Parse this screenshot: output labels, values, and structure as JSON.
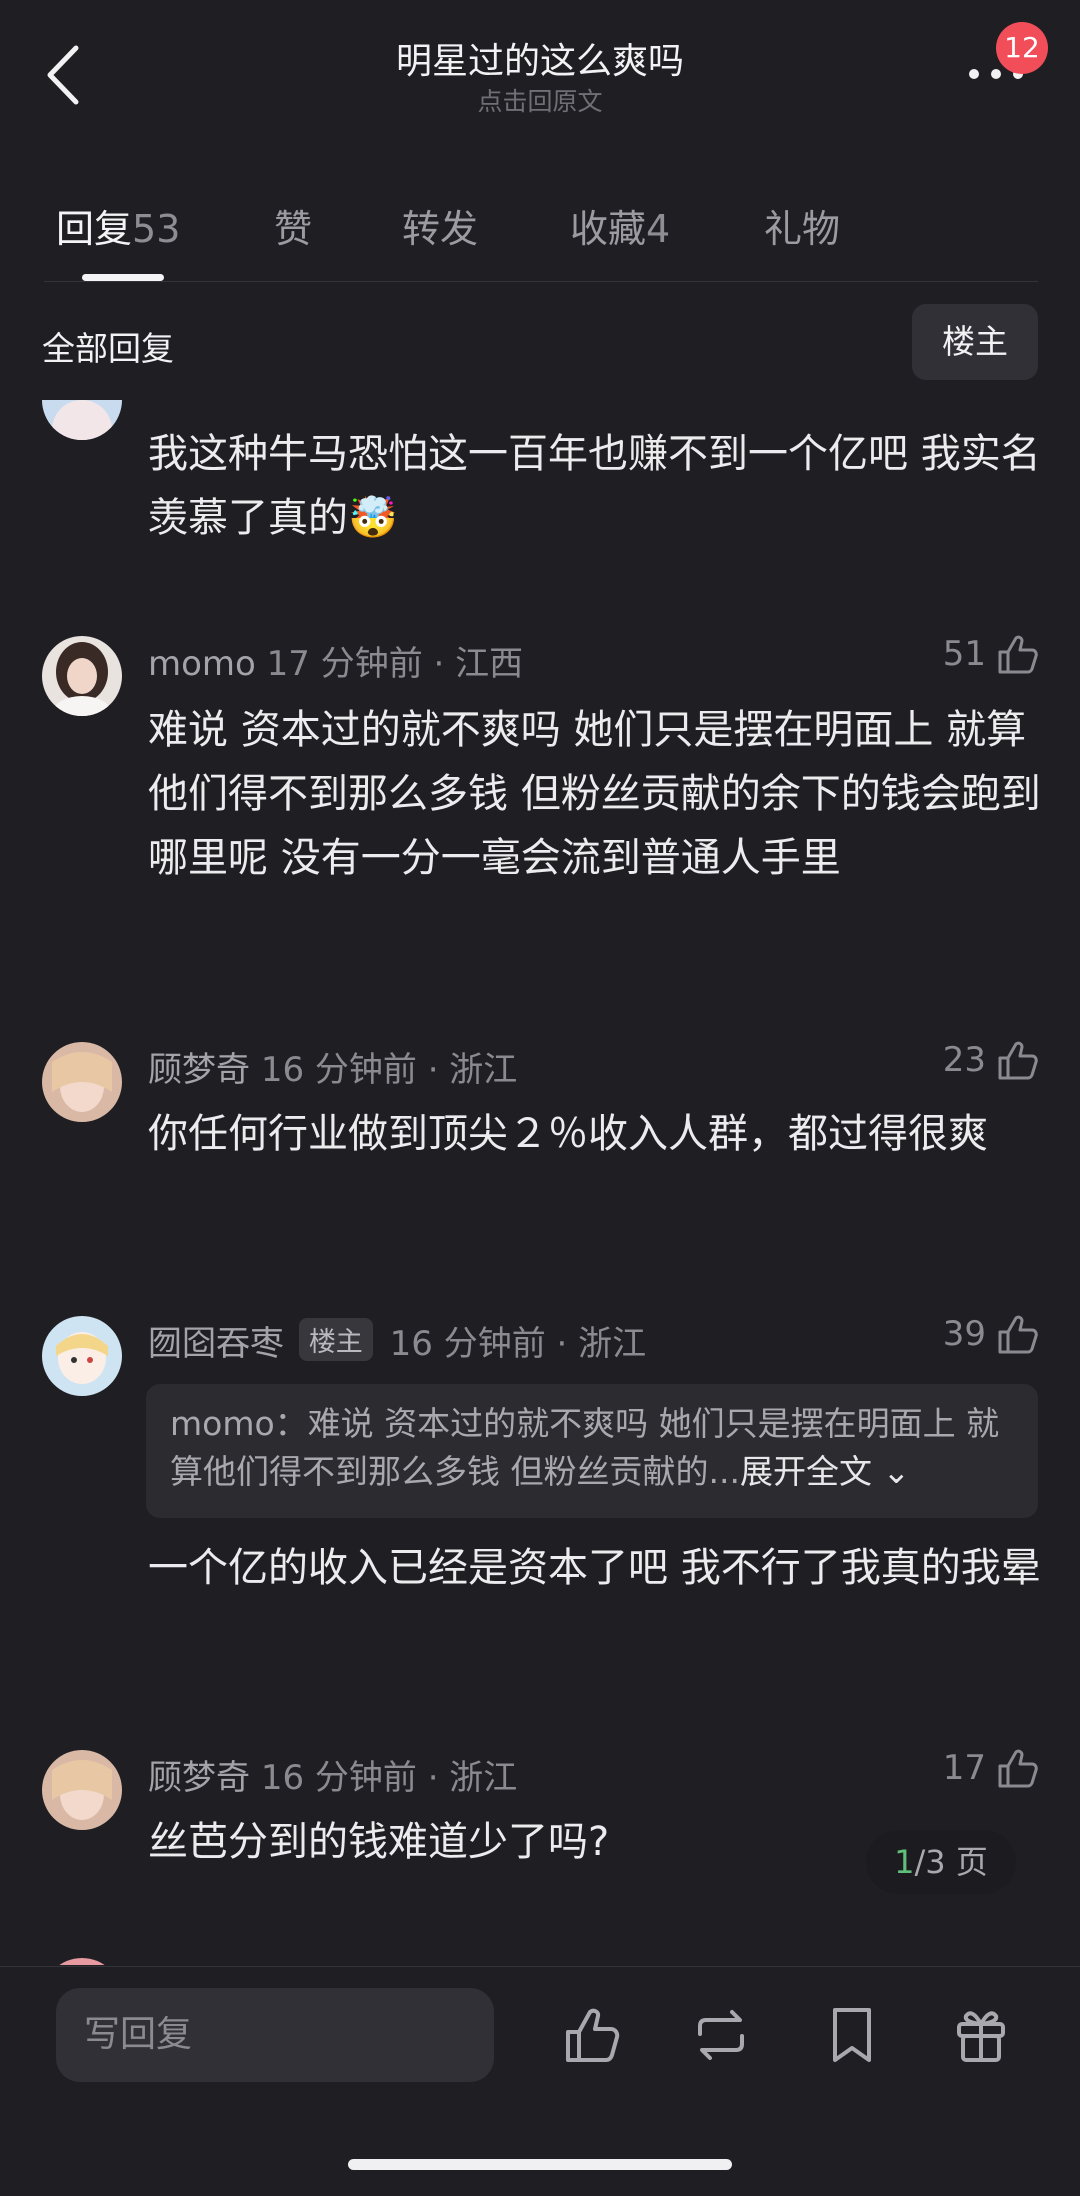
{
  "header": {
    "title": "明星过的这么爽吗",
    "subtitle": "点击回原文",
    "notification_count": "12"
  },
  "tabs": [
    {
      "label": "回复",
      "count": "53"
    },
    {
      "label": "赞",
      "count": ""
    },
    {
      "label": "转发",
      "count": ""
    },
    {
      "label": "收藏",
      "count": "4"
    },
    {
      "label": "礼物",
      "count": ""
    }
  ],
  "filter": {
    "label": "全部回复",
    "op_button": "楼主"
  },
  "comments": [
    {
      "name": "",
      "meta": "",
      "likes": "",
      "body": "我这种牛马恐怕这一百年也赚不到一个亿吧 我实名羡慕了真的🤯"
    },
    {
      "name": "momo",
      "meta": "17 分钟前 · 江西",
      "likes": "51",
      "body": "难说 资本过的就不爽吗 她们只是摆在明面上 就算他们得不到那么多钱 但粉丝贡献的余下的钱会跑到哪里呢 没有一分一毫会流到普通人手里"
    },
    {
      "name": "顾梦奇",
      "meta": "16 分钟前 · 浙江",
      "likes": "23",
      "body": "你任何行业做到顶尖２％收入人群，都过得很爽"
    },
    {
      "name": "囫囵吞枣",
      "op_tag": "楼主",
      "meta": "16 分钟前 · 浙江",
      "likes": "39",
      "quote": "momo：难说 资本过的就不爽吗 她们只是摆在明面上 就算他们得不到那么多钱 但粉丝贡献的...",
      "quote_expand": "展开全文",
      "body": "一个亿的收入已经是资本了吧 我不行了我真的我晕"
    },
    {
      "name": "顾梦奇",
      "meta": "16 分钟前 · 浙江",
      "likes": "17",
      "body": "丝芭分到的钱难道少了吗?"
    }
  ],
  "pagination": {
    "current": "1",
    "total": "/3 页"
  },
  "bottom_bar": {
    "reply_placeholder": "写回复"
  },
  "colors": {
    "background": "#1f1f23",
    "badge": "#f24e5a",
    "page_current": "#5fbf7b"
  },
  "icons": [
    "back-icon",
    "more-icon",
    "thumbs-up-icon",
    "repost-icon",
    "bookmark-icon",
    "gift-icon"
  ]
}
